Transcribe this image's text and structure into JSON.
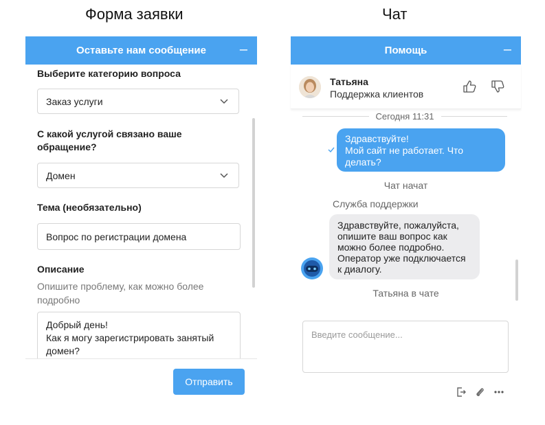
{
  "captions": {
    "left": "Форма заявки",
    "right": "Чат"
  },
  "form": {
    "header_title": "Оставьте нам сообщение",
    "minimize_label": "–",
    "category_label": "Выберите категорию вопроса",
    "category_value": "Заказ услуги",
    "service_label": "С какой услугой связано ваше обращение?",
    "service_value": "Домен",
    "topic_label": "Тема (необязательно)",
    "topic_value": "Вопрос по регистрации домена",
    "description_label": "Описание",
    "description_hint": "Опишите проблему, как можно более подробно",
    "description_value": "Добрый день!\nКак я могу зарегистрировать занятый домен?",
    "send_label": "Отправить"
  },
  "chat": {
    "header_title": "Помощь",
    "minimize_label": "–",
    "agent_name": "Татьяна",
    "agent_role": "Поддержка клиентов",
    "date_separator": "Сегодня 11:31",
    "user_message": "Здравствуйте!\nМой сайт не работает. Что делать?",
    "chat_started": "Чат начат",
    "bot_sender": "Служба поддержки",
    "bot_message": "Здравствуйте, пожалуйста, опишите ваш вопрос как можно более подробно. Оператор уже подключается к диалогу.",
    "agent_joined": "Татьяна в чате",
    "input_placeholder": "Введите сообщение..."
  },
  "icons": [
    "chevron-down-icon",
    "thumbs-up-icon",
    "thumbs-down-icon",
    "check-icon",
    "bot-icon",
    "exit-icon",
    "paperclip-icon",
    "more-icon"
  ],
  "colors": {
    "accent": "#4aa3f0",
    "bot_bubble": "#ececee"
  }
}
